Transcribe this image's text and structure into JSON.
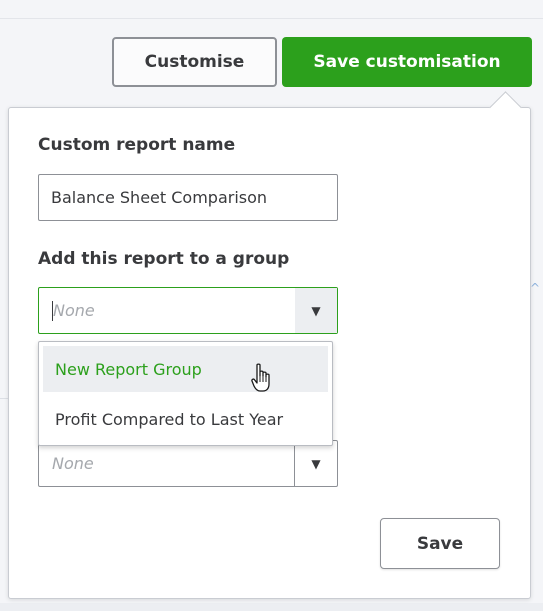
{
  "header": {
    "customise_label": "Customise",
    "save_customisation_label": "Save customisation"
  },
  "form": {
    "name_label": "Custom report name",
    "name_value": "Balance Sheet Comparison",
    "group_label": "Add this report to a group",
    "group_placeholder": "None",
    "second_select_placeholder": "None",
    "save_label": "Save"
  },
  "dropdown": {
    "options": [
      "New Report Group",
      "Profit Compared to Last Year"
    ],
    "highlighted": "New Report Group"
  },
  "colors": {
    "brand_green": "#2ca01c",
    "text": "#393a3d",
    "border": "#8d9096",
    "placeholder": "#a5a8ad",
    "highlight_bg": "#eceef1"
  },
  "icons": {
    "dropdown_arrow": "▼",
    "cursor": "hand-pointer",
    "bg_chevron": "chevron-up"
  }
}
